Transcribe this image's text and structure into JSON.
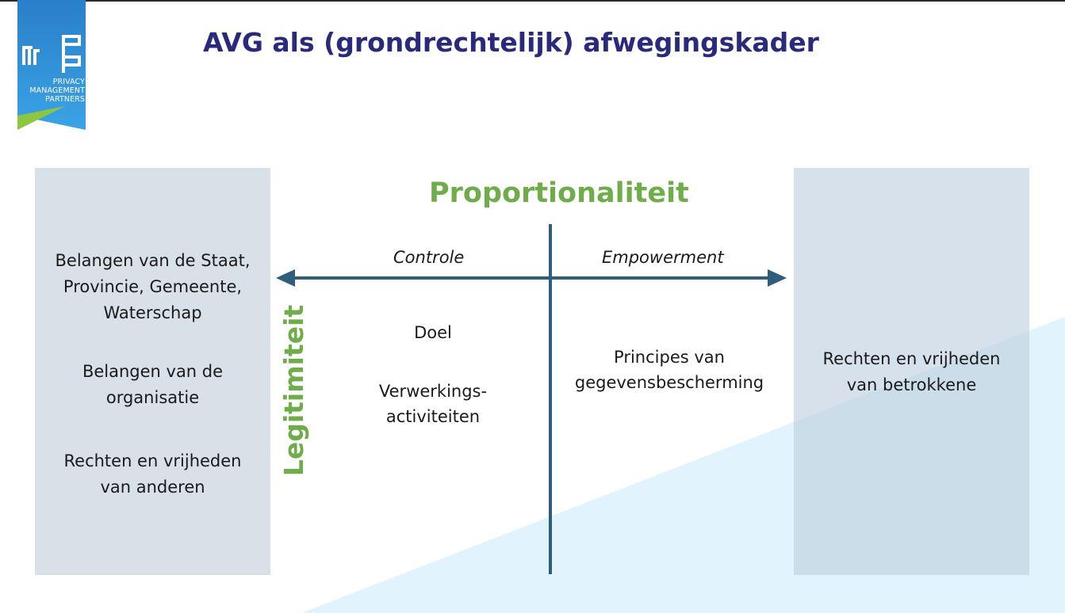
{
  "header": {
    "title": "AVG als (grondrechtelijk) afwegingskader"
  },
  "logo": {
    "lines": [
      "PRIVACY",
      "MANAGEMENT",
      "PARTNERS"
    ]
  },
  "diagram": {
    "top_label": "Proportionaliteit",
    "side_label": "Legitimiteit",
    "axis_left_label": "Controle",
    "axis_right_label": "Empowerment",
    "left_quadrant_items": [
      "Doel",
      "Verwerkings-\nactiviteiten"
    ],
    "right_quadrant_items": [
      "Principes van\ngegevensbescherming"
    ]
  },
  "left_panel": {
    "items": [
      "Belangen van de Staat,\nProvincie, Gemeente,\nWaterschap",
      "Belangen van de\norganisatie",
      "Rechten en vrijheden\nvan anderen"
    ]
  },
  "right_panel": {
    "items": [
      "Rechten en vrijheden\nvan betrokkene"
    ]
  },
  "colors": {
    "title": "#2a2a7c",
    "green_label": "#6fac4a",
    "axis": "#2f5d7c",
    "left_panel": "#d8e0e8",
    "right_panel": "#bfcfdf",
    "background_wedge": "#e1f3fc",
    "logo_blue": "#2e8fd6",
    "logo_green": "#8dc63f"
  }
}
